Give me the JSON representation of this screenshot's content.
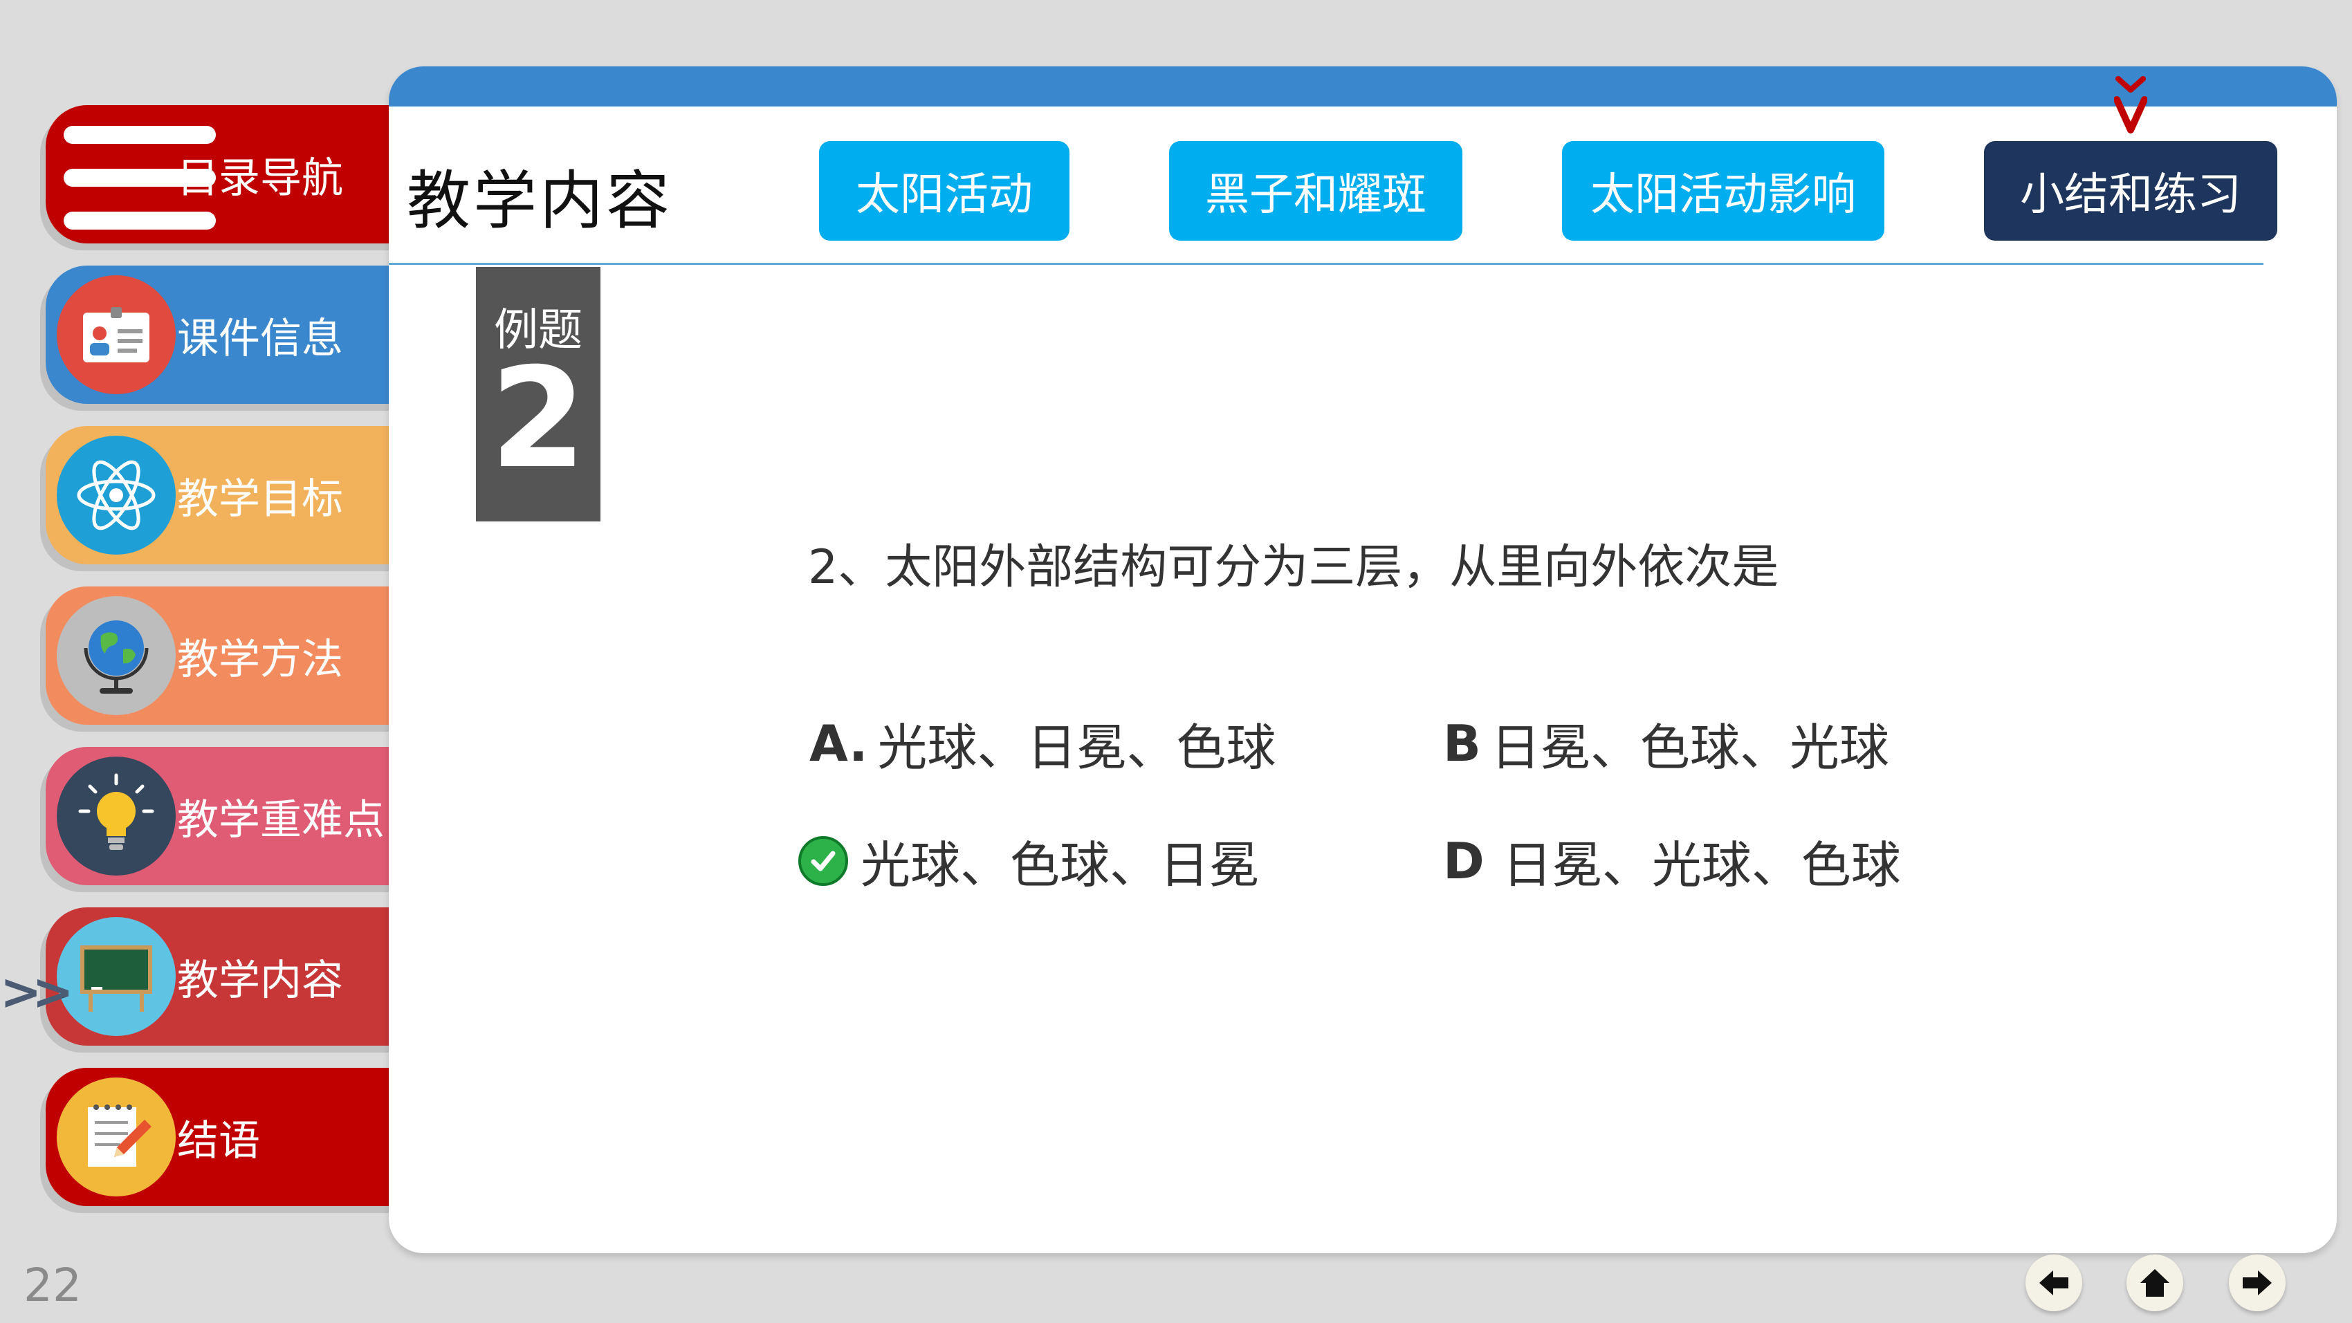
{
  "sidebar": {
    "items": [
      {
        "label": "目录导航",
        "color": "#c00000",
        "icon": "menu-icon"
      },
      {
        "label": "课件信息",
        "color": "#3b87cd",
        "icon": "id-card-icon"
      },
      {
        "label": "教学目标",
        "color": "#f2b25c",
        "icon": "atom-icon"
      },
      {
        "label": "教学方法",
        "color": "#f28c5e",
        "icon": "globe-icon"
      },
      {
        "label": "教学重难点",
        "color": "#e05c74",
        "icon": "lightbulb-icon"
      },
      {
        "label": "教学内容",
        "color": "#c83737",
        "icon": "blackboard-icon",
        "active": true
      },
      {
        "label": "结语",
        "color": "#c00000",
        "icon": "notepad-icon"
      }
    ],
    "active_indicator": ">>"
  },
  "header": {
    "title": "教学内容",
    "tabs": [
      {
        "label": "太阳活动"
      },
      {
        "label": "黑子和耀斑"
      },
      {
        "label": "太阳活动影响"
      },
      {
        "label": "小结和练习",
        "active": true
      }
    ],
    "accent_color": "#3b87cd",
    "active_tab_color": "#1e355e",
    "tab_color": "#00aeef"
  },
  "example": {
    "label": "例题",
    "number": "2"
  },
  "question": {
    "text": "2、太阳外部结构可分为三层，从里向外依次是",
    "options": [
      {
        "letter": "A.",
        "text": "光球、日冕、色球"
      },
      {
        "letter": "B",
        "text": "日冕、色球、光球"
      },
      {
        "letter": "",
        "text": "光球、色球、日冕",
        "correct": true,
        "icon": "check-icon"
      },
      {
        "letter": "D",
        "text": "日冕、光球、色球"
      }
    ]
  },
  "footer": {
    "page_number": "22",
    "nav": [
      "back-arrow-icon",
      "home-icon",
      "forward-arrow-icon"
    ]
  }
}
